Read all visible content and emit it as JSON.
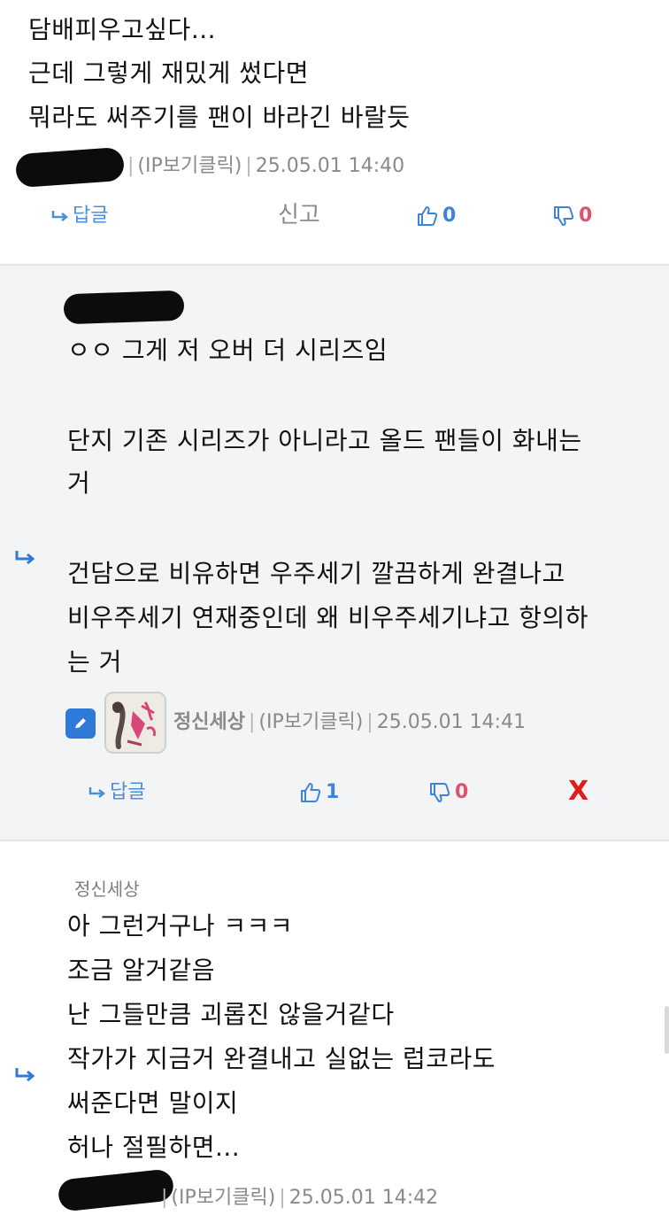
{
  "comments": [
    {
      "lines": [
        "담배피우고싶다...",
        "근데 그렇게 재밌게 썼다면",
        "뭐라도 써주기를 팬이 바라긴 바랄듯"
      ],
      "ip_link": "(IP보기클릭)",
      "timestamp": "25.05.01 14:40",
      "reply_label": "답글",
      "report_label": "신고",
      "likes": "0",
      "dislikes": "0"
    },
    {
      "lines": [
        "ㅇㅇ 그게 저 오버 더 시리즈임",
        "",
        "단지 기존 시리즈가 아니라고 올드 팬들이 화내는",
        "거",
        "",
        "건담으로 비유하면 우주세기 깔끔하게 완결나고",
        "비우주세기 연재중인데 왜 비우주세기냐고 항의하",
        "는 거"
      ],
      "nickname": "정신세상",
      "ip_link": "(IP보기클릭)",
      "timestamp": "25.05.01 14:41",
      "reply_label": "답글",
      "likes": "1",
      "dislikes": "0",
      "delete_label": "X"
    },
    {
      "parent_nickname": "정신세상",
      "lines": [
        "아 그런거구나 ㅋㅋㅋ",
        "조금 알거같음",
        "난 그들만큼 괴롭진 않을거같다",
        "작가가 지금거 완결내고 실없는 럽코라도",
        "써준다면 말이지",
        "허나 절필하면..."
      ],
      "ip_link": "(IP보기클릭)",
      "timestamp": "25.05.01 14:42"
    }
  ],
  "colors": {
    "accent_blue": "#3d84d8",
    "dislike_pink": "#e0506f",
    "delete_red": "#e21b1b",
    "reply_bg": "#f3f4f6"
  },
  "icons": [
    "reply-arrow-icon",
    "thumbs-up-icon",
    "thumbs-down-icon",
    "edit-pencil-icon",
    "avatar-image"
  ]
}
